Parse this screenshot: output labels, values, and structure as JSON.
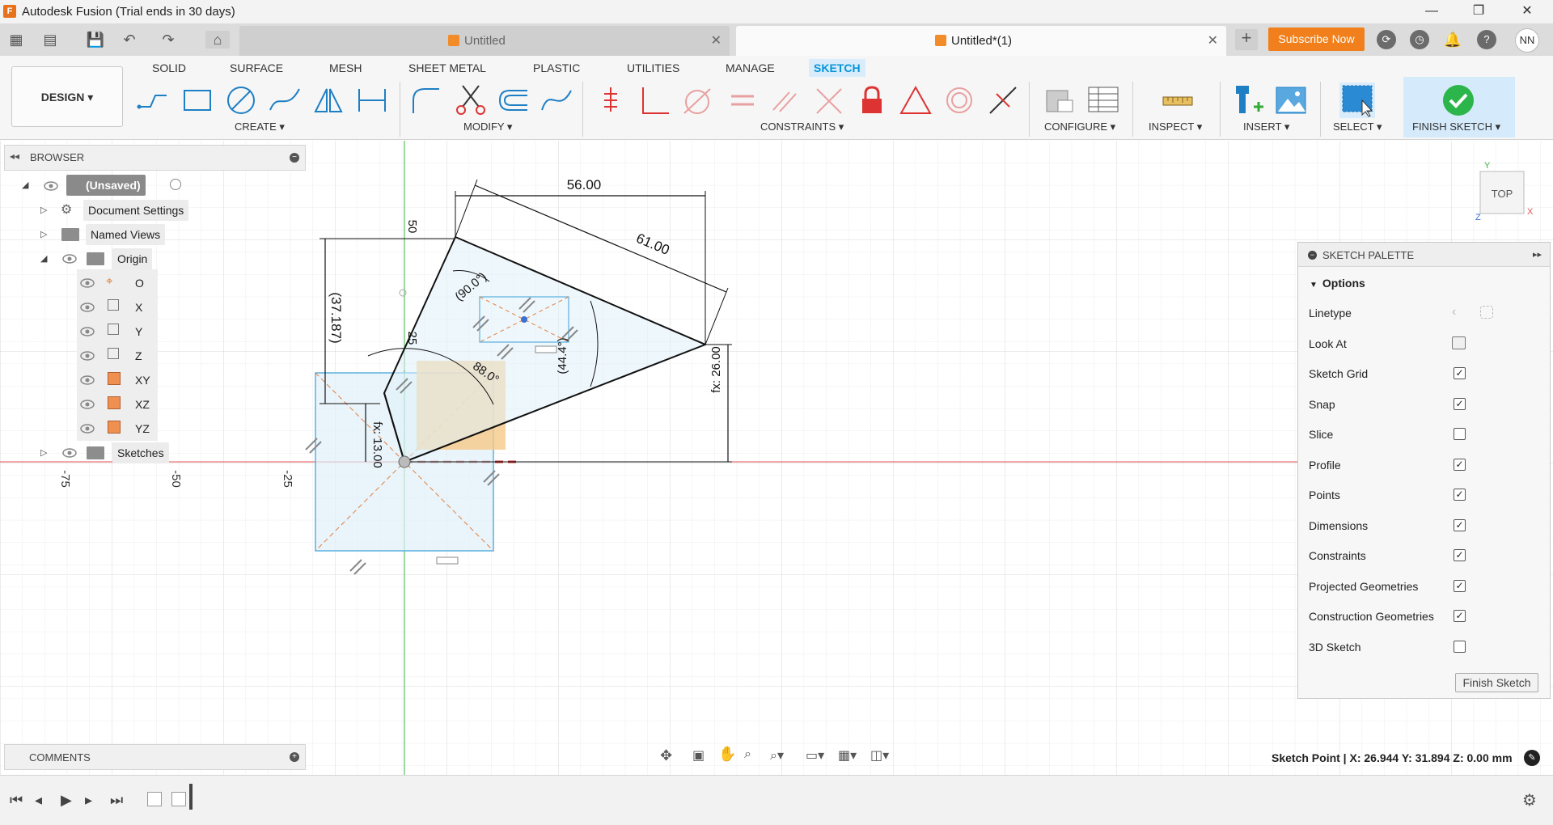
{
  "window": {
    "title": "Autodesk Fusion (Trial ends in 30 days)",
    "app_icon_letter": "F"
  },
  "tabs": [
    {
      "label": "Untitled",
      "active": false
    },
    {
      "label": "Untitled*(1)",
      "active": true
    }
  ],
  "header": {
    "subscribe_label": "Subscribe Now",
    "avatar_initials": "NN"
  },
  "ribbon": {
    "workspace_label": "DESIGN ▾",
    "tabs": [
      "SOLID",
      "SURFACE",
      "MESH",
      "SHEET METAL",
      "PLASTIC",
      "UTILITIES",
      "MANAGE",
      "SKETCH"
    ],
    "active_tab": "SKETCH",
    "groups": {
      "create": "CREATE ▾",
      "modify": "MODIFY ▾",
      "constraints": "CONSTRAINTS ▾",
      "configure": "CONFIGURE ▾",
      "inspect": "INSPECT ▾",
      "insert": "INSERT ▾",
      "select": "SELECT ▾",
      "finish": "FINISH SKETCH ▾"
    }
  },
  "browser": {
    "title": "BROWSER",
    "items": [
      {
        "label": "(Unsaved)"
      },
      {
        "label": "Document Settings"
      },
      {
        "label": "Named Views"
      },
      {
        "label": "Origin"
      },
      {
        "label": "O"
      },
      {
        "label": "X"
      },
      {
        "label": "Y"
      },
      {
        "label": "Z"
      },
      {
        "label": "XY"
      },
      {
        "label": "XZ"
      },
      {
        "label": "YZ"
      },
      {
        "label": "Sketches"
      }
    ]
  },
  "comments": {
    "title": "COMMENTS"
  },
  "canvas": {
    "axis_ticks": [
      "-75",
      "-50",
      "-25"
    ],
    "dimensions": {
      "width_top": "56.00",
      "diag": "61.00",
      "vert_left": "(37.187)",
      "v50": "50",
      "v25": "25",
      "angle90": "(90.0°)",
      "angle88": "88.0°",
      "angle44": "(44.4°)",
      "fx26": "fx: 26.00",
      "fx13": "fx: 13.00"
    },
    "viewcube": {
      "face": "TOP",
      "x": "X",
      "y": "Y",
      "z": "Z"
    }
  },
  "palette": {
    "title": "SKETCH PALETTE",
    "section": "Options",
    "rows": [
      {
        "label": "Linetype",
        "type": "icons"
      },
      {
        "label": "Look At",
        "type": "icon"
      },
      {
        "label": "Sketch Grid",
        "checked": true
      },
      {
        "label": "Snap",
        "checked": true
      },
      {
        "label": "Slice",
        "checked": false
      },
      {
        "label": "Profile",
        "checked": true
      },
      {
        "label": "Points",
        "checked": true
      },
      {
        "label": "Dimensions",
        "checked": true
      },
      {
        "label": "Constraints",
        "checked": true
      },
      {
        "label": "Projected Geometries",
        "checked": true
      },
      {
        "label": "Construction Geometries",
        "checked": true
      },
      {
        "label": "3D Sketch",
        "checked": false
      }
    ],
    "finish_label": "Finish Sketch"
  },
  "status": {
    "text": "Sketch Point | X: 26.944 Y: 31.894 Z: 0.00 mm"
  },
  "colors": {
    "accent": "#0696d7",
    "subscribe": "#f07f1c",
    "x_axis": "#e05050",
    "y_axis": "#3cb043",
    "profile_fill": "#e0f0fa",
    "construction": "#e08040"
  }
}
